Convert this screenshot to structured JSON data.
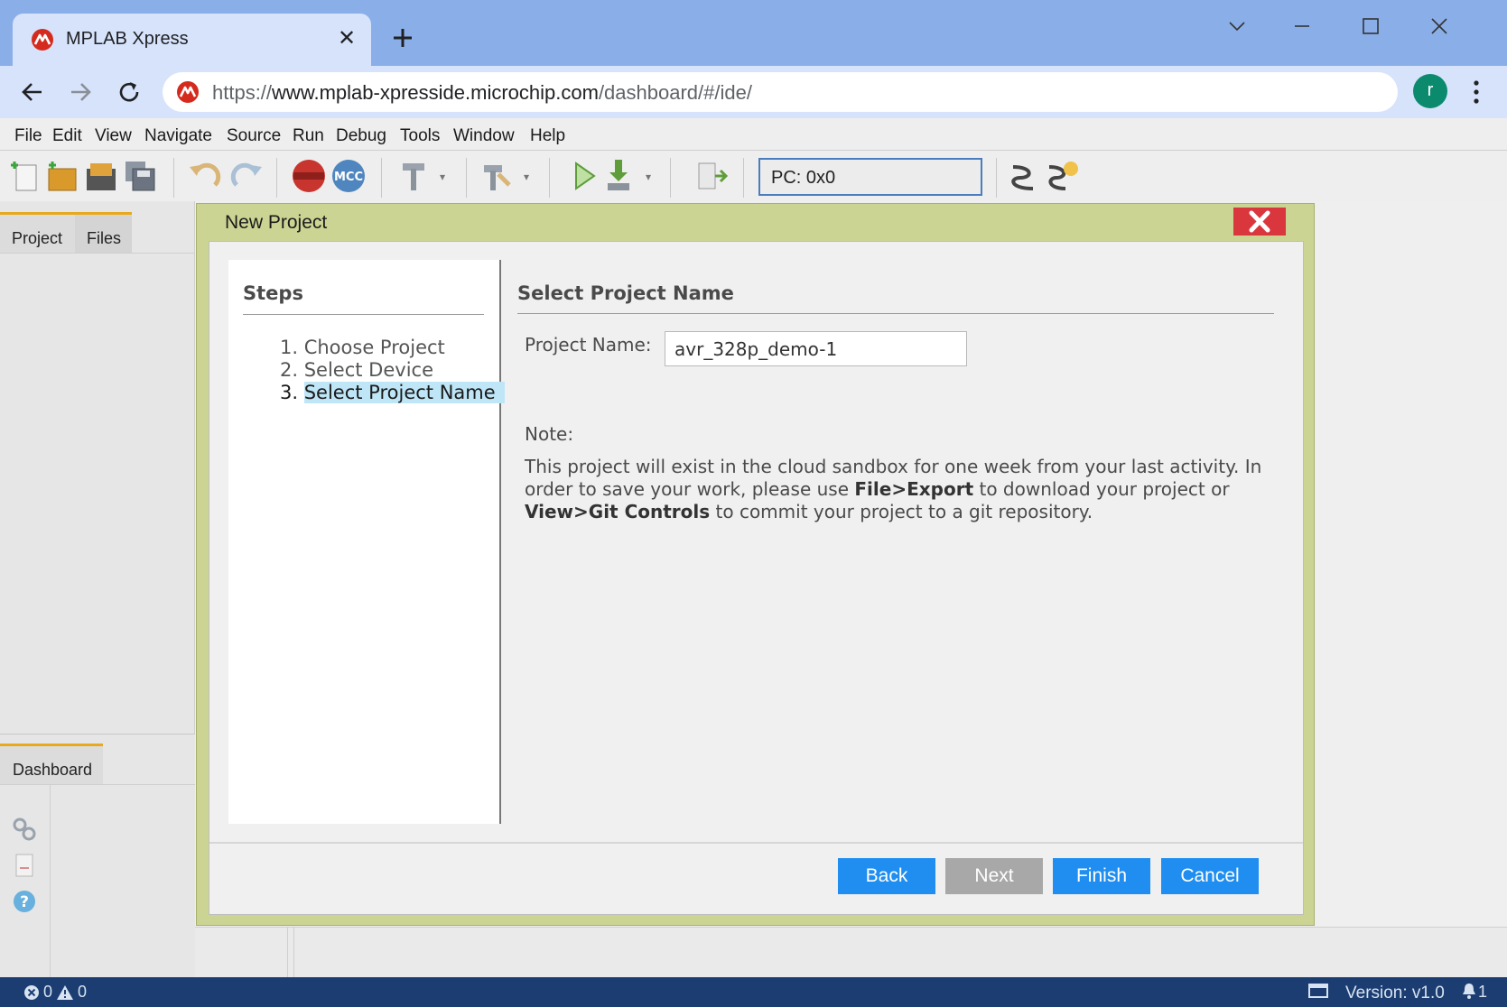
{
  "browser": {
    "tab_title": "MPLAB Xpress",
    "url_scheme": "https://",
    "url_host": "www.mplab-xpresside.microchip.com",
    "url_path": "/dashboard/#/ide/",
    "avatar_letter": "r",
    "brand_color": "#d52b1e"
  },
  "menu": [
    "File",
    "Edit",
    "View",
    "Navigate",
    "Source",
    "Run",
    "Debug",
    "Tools",
    "Window",
    "Help"
  ],
  "toolbar": {
    "pc_value": "PC: 0x0"
  },
  "left_panel": {
    "tabs": [
      "Project",
      "Files"
    ],
    "dashboard_tab": "Dashboard"
  },
  "dialog": {
    "title": "New Project",
    "steps_title": "Steps",
    "steps": [
      "1.  Choose Project",
      "2.  Select Device",
      "3.  "
    ],
    "current_step_label": "Select Project Name",
    "section_title": "Select Project Name",
    "project_name_label": "Project Name:",
    "project_name_value": "avr_328p_demo-1",
    "note_label": "Note:",
    "note_part1": "This project will exist in the cloud sandbox for one week from your last activity. In order to save your work, please use ",
    "note_bold1": "File>Export",
    "note_part2": " to download your project or ",
    "note_bold2": "View>Git Controls",
    "note_part3": " to commit your project to a git repository.",
    "buttons": {
      "back": "Back",
      "next": "Next",
      "finish": "Finish",
      "cancel": "Cancel"
    }
  },
  "status": {
    "errors": "0",
    "warnings": "0",
    "version": "Version: v1.0",
    "notifications": "1"
  }
}
